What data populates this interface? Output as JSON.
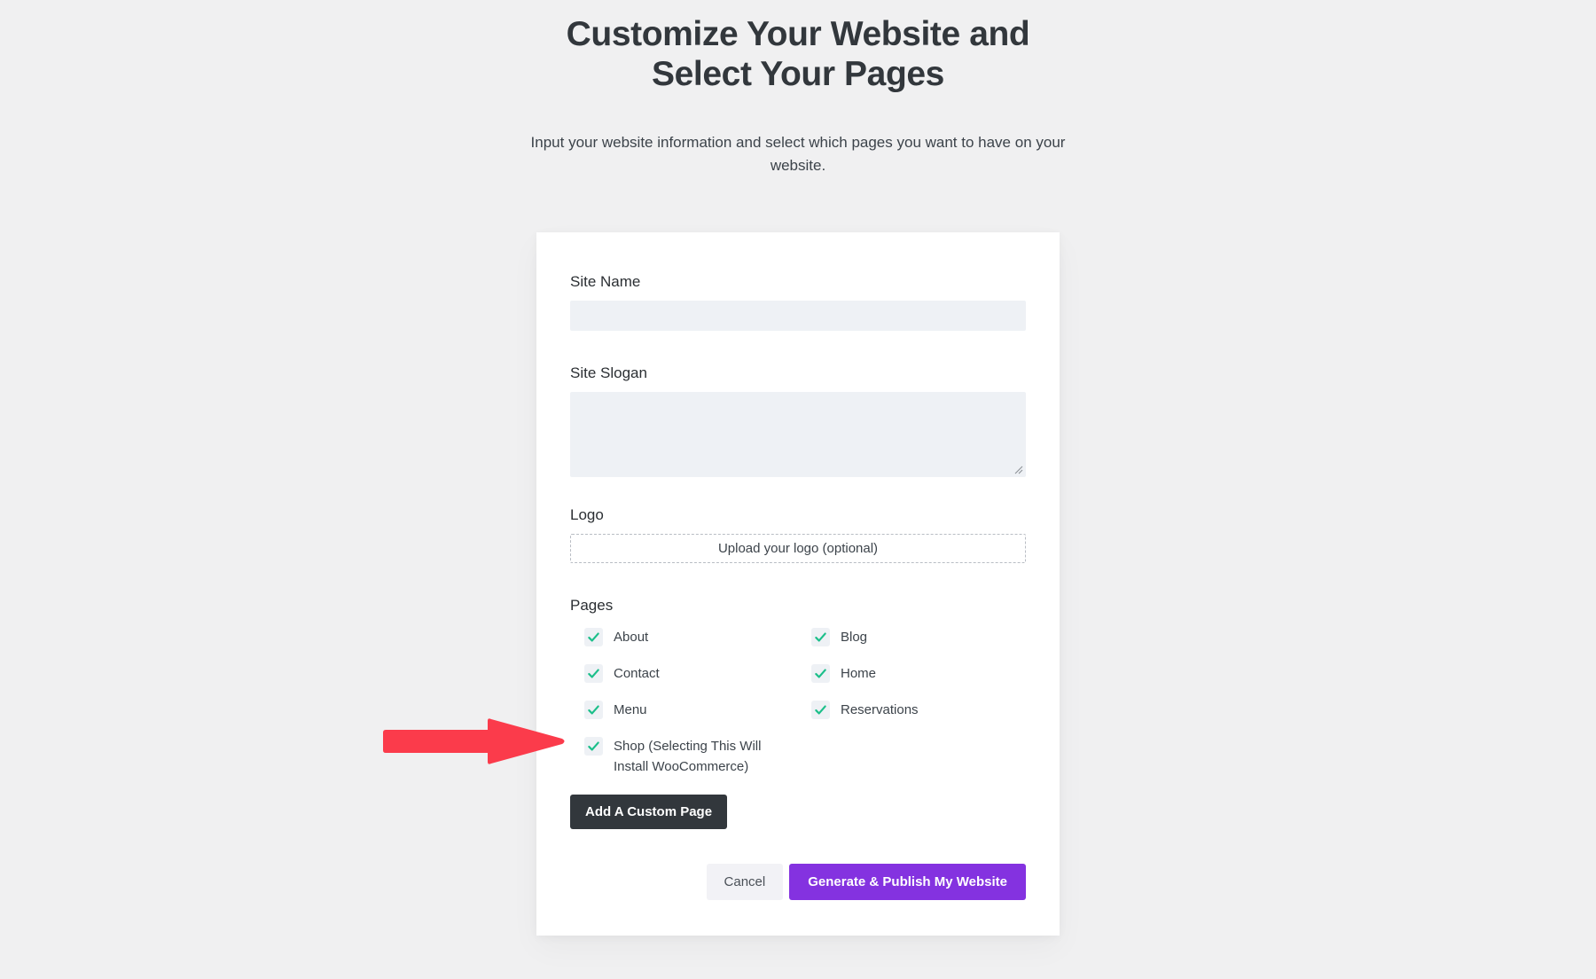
{
  "header": {
    "title": "Customize Your Website and Select Your Pages",
    "subtitle": "Input your website information and select which pages you want to have on your website."
  },
  "form": {
    "site_name": {
      "label": "Site Name",
      "value": "",
      "placeholder": ""
    },
    "site_slogan": {
      "label": "Site Slogan",
      "value": "",
      "placeholder": ""
    },
    "logo": {
      "label": "Logo",
      "upload_text": "Upload your logo (optional)"
    },
    "pages": {
      "label": "Pages",
      "options": [
        {
          "label": "About",
          "checked": true
        },
        {
          "label": "Blog",
          "checked": true
        },
        {
          "label": "Contact",
          "checked": true
        },
        {
          "label": "Home",
          "checked": true
        },
        {
          "label": "Menu",
          "checked": true
        },
        {
          "label": "Reservations",
          "checked": true
        },
        {
          "label": "Shop (Selecting This Will Install WooCommerce)",
          "checked": true
        }
      ]
    },
    "add_custom_page_label": "Add A Custom Page"
  },
  "actions": {
    "cancel_label": "Cancel",
    "primary_label": "Generate & Publish My Website"
  },
  "annotation": {
    "arrow": "red-right-arrow"
  },
  "colors": {
    "background": "#f0f0f1",
    "card": "#ffffff",
    "input_background": "#eef1f5",
    "checkmark": "#1bbf8a",
    "primary_button": "#8432e0",
    "dark_button": "#32373c",
    "cancel_button": "#f2f2f6",
    "arrow": "#fb3b4b",
    "text": "#32373c"
  }
}
